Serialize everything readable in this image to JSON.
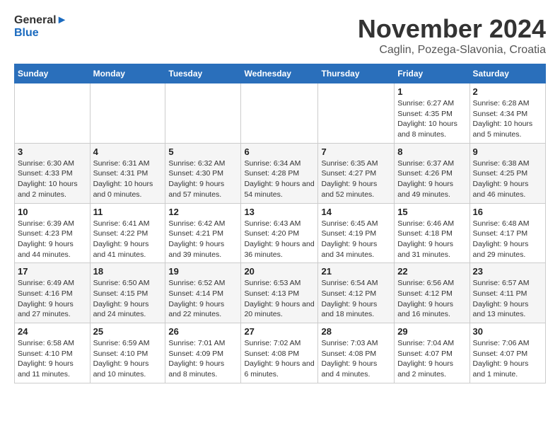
{
  "logo": {
    "line1": "General",
    "line2": "Blue"
  },
  "title": "November 2024",
  "location": "Caglin, Pozega-Slavonia, Croatia",
  "weekdays": [
    "Sunday",
    "Monday",
    "Tuesday",
    "Wednesday",
    "Thursday",
    "Friday",
    "Saturday"
  ],
  "weeks": [
    [
      {
        "day": "",
        "detail": ""
      },
      {
        "day": "",
        "detail": ""
      },
      {
        "day": "",
        "detail": ""
      },
      {
        "day": "",
        "detail": ""
      },
      {
        "day": "",
        "detail": ""
      },
      {
        "day": "1",
        "detail": "Sunrise: 6:27 AM\nSunset: 4:35 PM\nDaylight: 10 hours and 8 minutes."
      },
      {
        "day": "2",
        "detail": "Sunrise: 6:28 AM\nSunset: 4:34 PM\nDaylight: 10 hours and 5 minutes."
      }
    ],
    [
      {
        "day": "3",
        "detail": "Sunrise: 6:30 AM\nSunset: 4:33 PM\nDaylight: 10 hours and 2 minutes."
      },
      {
        "day": "4",
        "detail": "Sunrise: 6:31 AM\nSunset: 4:31 PM\nDaylight: 10 hours and 0 minutes."
      },
      {
        "day": "5",
        "detail": "Sunrise: 6:32 AM\nSunset: 4:30 PM\nDaylight: 9 hours and 57 minutes."
      },
      {
        "day": "6",
        "detail": "Sunrise: 6:34 AM\nSunset: 4:28 PM\nDaylight: 9 hours and 54 minutes."
      },
      {
        "day": "7",
        "detail": "Sunrise: 6:35 AM\nSunset: 4:27 PM\nDaylight: 9 hours and 52 minutes."
      },
      {
        "day": "8",
        "detail": "Sunrise: 6:37 AM\nSunset: 4:26 PM\nDaylight: 9 hours and 49 minutes."
      },
      {
        "day": "9",
        "detail": "Sunrise: 6:38 AM\nSunset: 4:25 PM\nDaylight: 9 hours and 46 minutes."
      }
    ],
    [
      {
        "day": "10",
        "detail": "Sunrise: 6:39 AM\nSunset: 4:23 PM\nDaylight: 9 hours and 44 minutes."
      },
      {
        "day": "11",
        "detail": "Sunrise: 6:41 AM\nSunset: 4:22 PM\nDaylight: 9 hours and 41 minutes."
      },
      {
        "day": "12",
        "detail": "Sunrise: 6:42 AM\nSunset: 4:21 PM\nDaylight: 9 hours and 39 minutes."
      },
      {
        "day": "13",
        "detail": "Sunrise: 6:43 AM\nSunset: 4:20 PM\nDaylight: 9 hours and 36 minutes."
      },
      {
        "day": "14",
        "detail": "Sunrise: 6:45 AM\nSunset: 4:19 PM\nDaylight: 9 hours and 34 minutes."
      },
      {
        "day": "15",
        "detail": "Sunrise: 6:46 AM\nSunset: 4:18 PM\nDaylight: 9 hours and 31 minutes."
      },
      {
        "day": "16",
        "detail": "Sunrise: 6:48 AM\nSunset: 4:17 PM\nDaylight: 9 hours and 29 minutes."
      }
    ],
    [
      {
        "day": "17",
        "detail": "Sunrise: 6:49 AM\nSunset: 4:16 PM\nDaylight: 9 hours and 27 minutes."
      },
      {
        "day": "18",
        "detail": "Sunrise: 6:50 AM\nSunset: 4:15 PM\nDaylight: 9 hours and 24 minutes."
      },
      {
        "day": "19",
        "detail": "Sunrise: 6:52 AM\nSunset: 4:14 PM\nDaylight: 9 hours and 22 minutes."
      },
      {
        "day": "20",
        "detail": "Sunrise: 6:53 AM\nSunset: 4:13 PM\nDaylight: 9 hours and 20 minutes."
      },
      {
        "day": "21",
        "detail": "Sunrise: 6:54 AM\nSunset: 4:12 PM\nDaylight: 9 hours and 18 minutes."
      },
      {
        "day": "22",
        "detail": "Sunrise: 6:56 AM\nSunset: 4:12 PM\nDaylight: 9 hours and 16 minutes."
      },
      {
        "day": "23",
        "detail": "Sunrise: 6:57 AM\nSunset: 4:11 PM\nDaylight: 9 hours and 13 minutes."
      }
    ],
    [
      {
        "day": "24",
        "detail": "Sunrise: 6:58 AM\nSunset: 4:10 PM\nDaylight: 9 hours and 11 minutes."
      },
      {
        "day": "25",
        "detail": "Sunrise: 6:59 AM\nSunset: 4:10 PM\nDaylight: 9 hours and 10 minutes."
      },
      {
        "day": "26",
        "detail": "Sunrise: 7:01 AM\nSunset: 4:09 PM\nDaylight: 9 hours and 8 minutes."
      },
      {
        "day": "27",
        "detail": "Sunrise: 7:02 AM\nSunset: 4:08 PM\nDaylight: 9 hours and 6 minutes."
      },
      {
        "day": "28",
        "detail": "Sunrise: 7:03 AM\nSunset: 4:08 PM\nDaylight: 9 hours and 4 minutes."
      },
      {
        "day": "29",
        "detail": "Sunrise: 7:04 AM\nSunset: 4:07 PM\nDaylight: 9 hours and 2 minutes."
      },
      {
        "day": "30",
        "detail": "Sunrise: 7:06 AM\nSunset: 4:07 PM\nDaylight: 9 hours and 1 minute."
      }
    ]
  ]
}
